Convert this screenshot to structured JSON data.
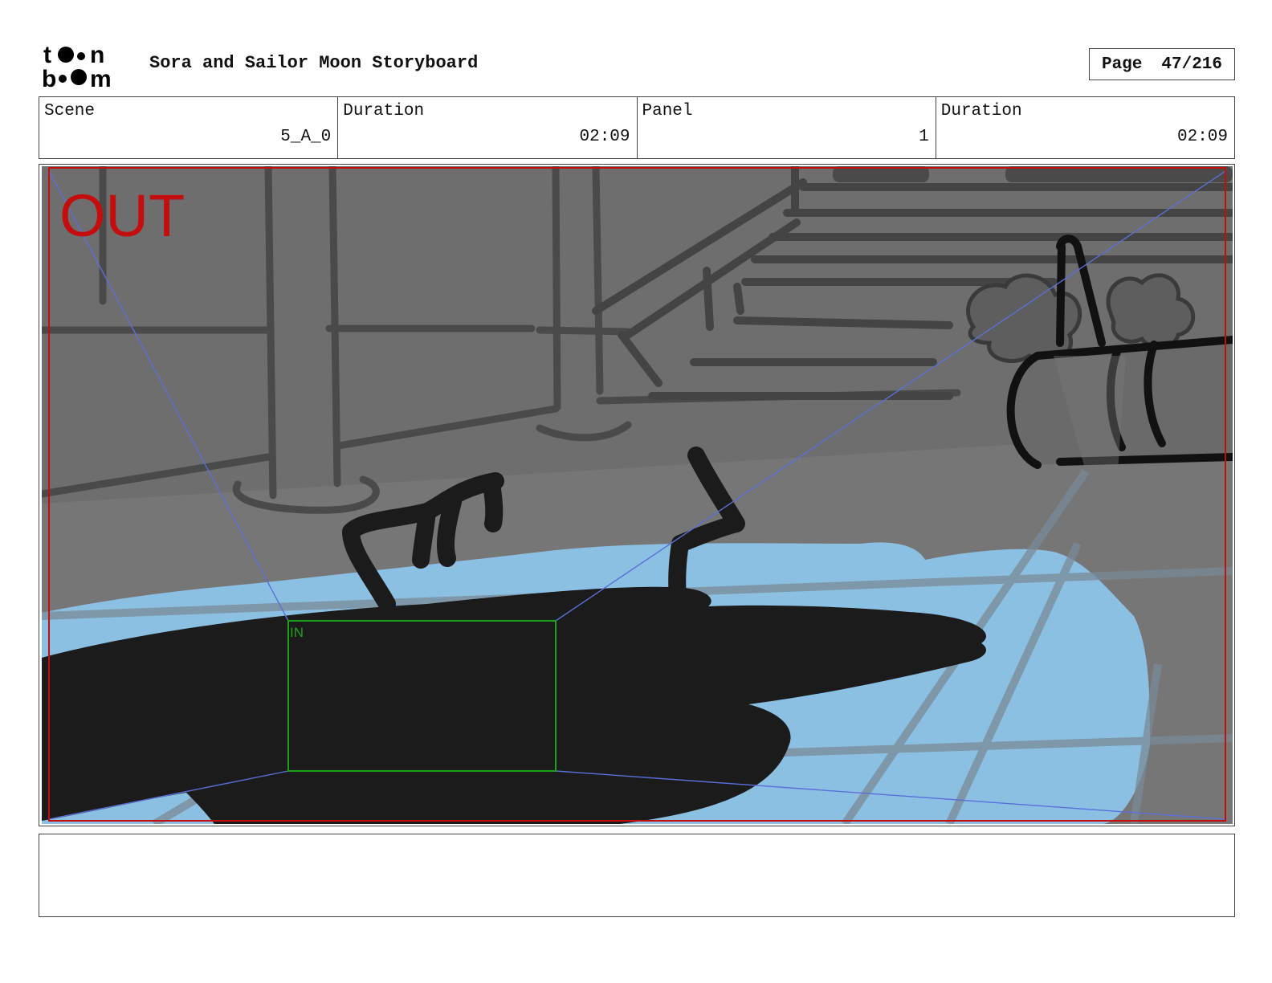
{
  "header": {
    "logo_text": "toon boom",
    "title": "Sora and Sailor Moon Storyboard",
    "page_label": "Page",
    "page_value": "47/216"
  },
  "info": [
    {
      "label": "Scene",
      "value": "5_A_0"
    },
    {
      "label": "Duration",
      "value": "02:09"
    },
    {
      "label": "Panel",
      "value": "1"
    },
    {
      "label": "Duration",
      "value": "02:09"
    }
  ],
  "panel": {
    "out_label": "OUT",
    "in_label": "IN"
  },
  "notes": {
    "text": ""
  },
  "colors": {
    "floor_gray": "#6e6e6e",
    "water_blue": "#8cc0e3",
    "silhouette": "#1b1b1b",
    "out_frame_red": "#c40d0d",
    "in_frame_green": "#1aa31a",
    "guide_blue": "#5b6fd6"
  }
}
